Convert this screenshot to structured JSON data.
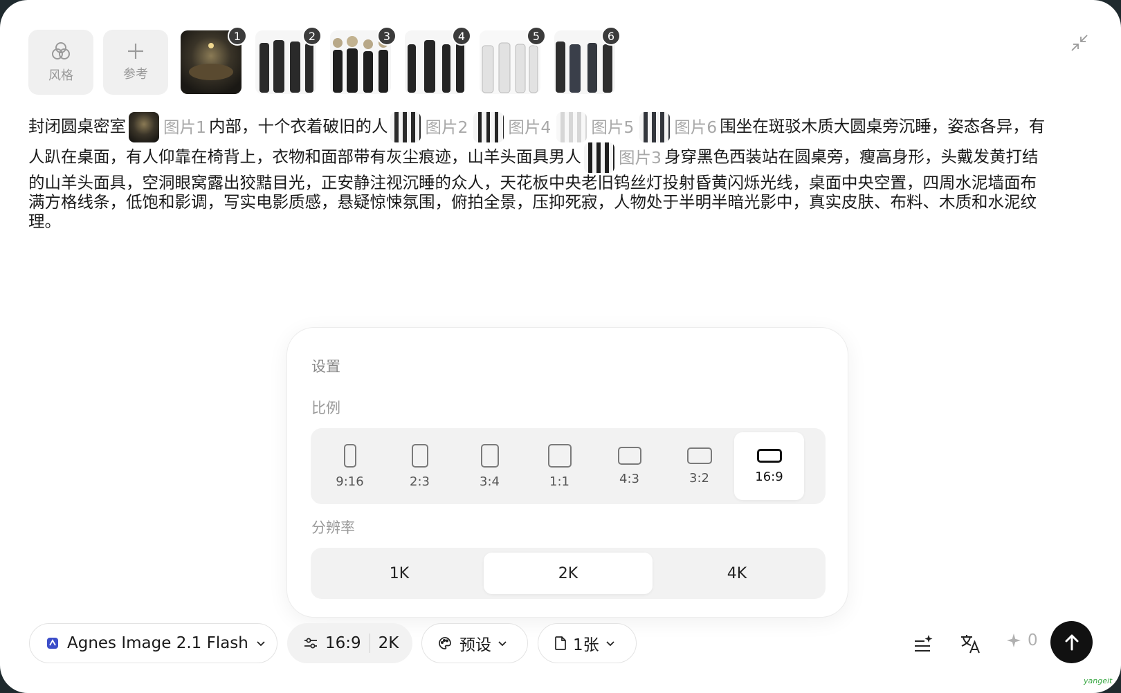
{
  "toolbar_tiles": [
    {
      "label": "风格",
      "icon": "style-circles-icon"
    },
    {
      "label": "参考",
      "icon": "plus-icon"
    }
  ],
  "thumbnails": [
    "1",
    "2",
    "3",
    "4",
    "5",
    "6"
  ],
  "prompt": {
    "t1": "封闭圆桌密室",
    "ref1": "图片1",
    "t2": "内部，十个衣着破旧的人",
    "ref2": "图片2",
    "ref4": "图片4",
    "ref5": "图片5",
    "ref6": "图片6",
    "t3": "围坐在斑驳木质大圆桌旁沉睡，姿态各异，有人趴在桌面，有人仰靠在椅背上，衣物和面部带有灰尘痕迹，山羊头面具男人",
    "ref3": "图片3",
    "t4": "身穿黑色西装站在圆桌旁，瘦高身形，头戴发黄打结的山羊头面具，空洞眼窝露出狡黠目光，正安静注视沉睡的众人，天花板中央老旧钨丝灯投射昏黄闪烁光线，桌面中央空置，四周水泥墙面布满方格线条，低饱和影调，写实电影质感，悬疑惊悚氛围，俯拍全景，压抑死寂，人物处于半明半暗光影中，真实皮肤、布料、木质和水泥纹理。"
  },
  "settings": {
    "title": "设置",
    "ratio_title": "比例",
    "ratios": [
      "9:16",
      "2:3",
      "3:4",
      "1:1",
      "4:3",
      "3:2",
      "16:9"
    ],
    "selected_ratio": "16:9",
    "resolution_title": "分辨率",
    "resolutions": [
      "1K",
      "2K",
      "4K"
    ],
    "selected_resolution": "2K"
  },
  "bottom": {
    "model": "Agnes Image 2.1 Flash",
    "ratio": "16:9",
    "resolution": "2K",
    "preset": "预设",
    "count": "1张",
    "credits": "0"
  },
  "watermark": "yangeit"
}
